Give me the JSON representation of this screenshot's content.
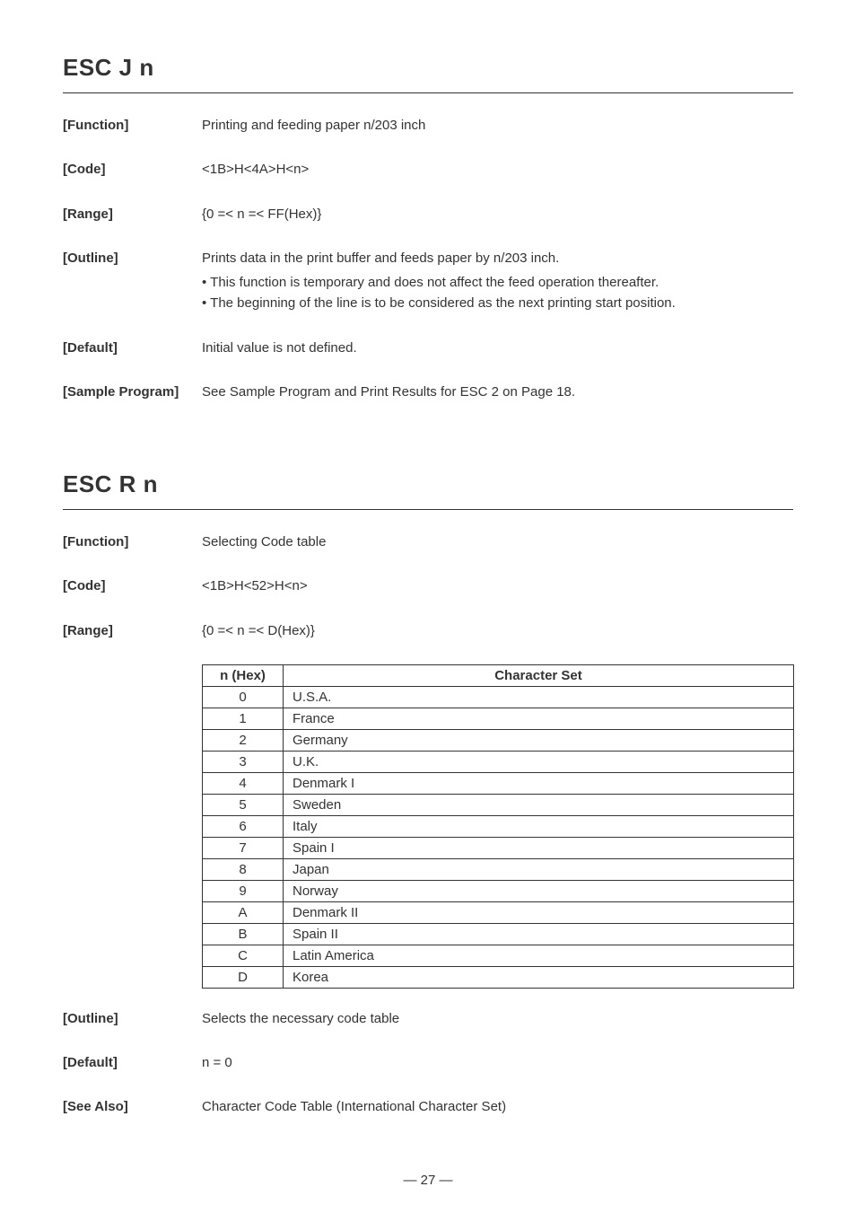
{
  "section1": {
    "title": "ESC J n",
    "rows": {
      "function": {
        "label": "[Function]",
        "value": "Printing and feeding paper n/203 inch"
      },
      "code": {
        "label": "[Code]",
        "value": "<1B>H<4A>H<n>"
      },
      "range": {
        "label": "[Range]",
        "value": "{0 =< n =< FF(Hex)}"
      },
      "outline": {
        "label": "[Outline]",
        "value": "Prints data in the print buffer and feeds paper by n/203 inch.",
        "bullets": [
          "This function is temporary and does not affect the feed operation thereafter.",
          "The beginning of the line is to be considered as the next printing start position."
        ]
      },
      "default": {
        "label": "[Default]",
        "value": "Initial value is not defined."
      },
      "sample": {
        "label": "[Sample Program]",
        "value": "See Sample Program and Print Results for ESC 2 on Page 18."
      }
    }
  },
  "section2": {
    "title": "ESC R n",
    "rows": {
      "function": {
        "label": "[Function]",
        "value": "Selecting Code table"
      },
      "code": {
        "label": "[Code]",
        "value": "<1B>H<52>H<n>"
      },
      "range": {
        "label": "[Range]",
        "value": "{0 =< n =< D(Hex)}"
      }
    },
    "table": {
      "headers": {
        "nhex": "n (Hex)",
        "charset": "Character Set"
      },
      "rows": [
        {
          "n": "0",
          "cs": "U.S.A."
        },
        {
          "n": "1",
          "cs": "France"
        },
        {
          "n": "2",
          "cs": "Germany"
        },
        {
          "n": "3",
          "cs": "U.K."
        },
        {
          "n": "4",
          "cs": "Denmark I"
        },
        {
          "n": "5",
          "cs": "Sweden"
        },
        {
          "n": "6",
          "cs": "Italy"
        },
        {
          "n": "7",
          "cs": "Spain I"
        },
        {
          "n": "8",
          "cs": "Japan"
        },
        {
          "n": "9",
          "cs": "Norway"
        },
        {
          "n": "A",
          "cs": "Denmark II"
        },
        {
          "n": "B",
          "cs": "Spain II"
        },
        {
          "n": "C",
          "cs": "Latin America"
        },
        {
          "n": "D",
          "cs": "Korea"
        }
      ]
    },
    "rows2": {
      "outline": {
        "label": "[Outline]",
        "value": "Selects the necessary code table"
      },
      "default": {
        "label": "[Default]",
        "value": "n = 0"
      },
      "seealso": {
        "label": "[See Also]",
        "value": "Character Code Table (International Character Set)"
      }
    }
  },
  "page_number": "— 27 —"
}
